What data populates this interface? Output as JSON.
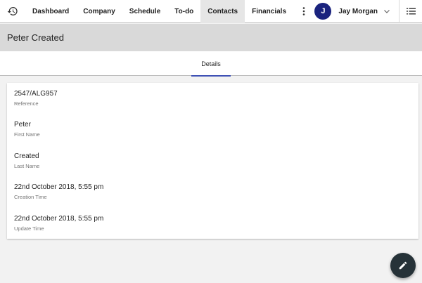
{
  "nav": {
    "items": [
      {
        "label": "Dashboard"
      },
      {
        "label": "Company"
      },
      {
        "label": "Schedule"
      },
      {
        "label": "To-do"
      },
      {
        "label": "Contacts",
        "active": true
      },
      {
        "label": "Financials"
      }
    ],
    "user": {
      "initial": "J",
      "name": "Jay Morgan"
    },
    "icons": {
      "history": "history-icon",
      "more": "more-vert-icon",
      "caret": "chevron-down-icon",
      "list": "list-icon"
    }
  },
  "page": {
    "title": "Peter Created"
  },
  "tabs": [
    {
      "label": "Details",
      "active": true
    }
  ],
  "details": [
    {
      "value": "2547/ALG957",
      "label": "Reference"
    },
    {
      "value": "Peter",
      "label": "First Name"
    },
    {
      "value": "Created",
      "label": "Last Name"
    },
    {
      "value": "22nd October 2018, 5:55 pm",
      "label": "Creation Time"
    },
    {
      "value": "22nd October 2018, 5:55 pm",
      "label": "Update Time"
    }
  ],
  "fab": {
    "icon": "edit-icon"
  },
  "colors": {
    "accent": "#3f51b5",
    "avatar": "#1a237e",
    "fab": "#263238",
    "titlebar": "#d9d9d9"
  }
}
